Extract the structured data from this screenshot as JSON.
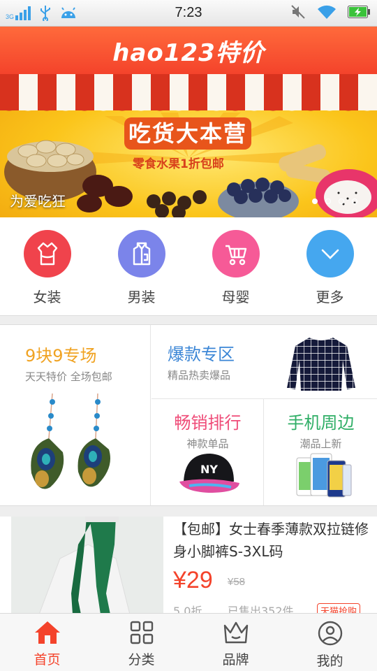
{
  "status_bar": {
    "network": "3G",
    "time": "7:23"
  },
  "header": {
    "logo": "hao123特价"
  },
  "banner": {
    "title": "吃货大本营",
    "subtitle": "零食水果1折包邮",
    "caption": "为爱吃狂",
    "slides": 4,
    "active_slide": 1
  },
  "categories": [
    {
      "label": "女装",
      "icon": "dress-icon",
      "color": "#f0434c"
    },
    {
      "label": "男装",
      "icon": "shirt-icon",
      "color": "#7b84ea"
    },
    {
      "label": "母婴",
      "icon": "stroller-icon",
      "color": "#f65a97"
    },
    {
      "label": "更多",
      "icon": "chevron-down-icon",
      "color": "#45a7ef"
    }
  ],
  "promos": {
    "nine": {
      "title": "9块9专场",
      "subtitle": "天天特价 全场包邮",
      "color": "#f0a323"
    },
    "hot": {
      "title": "爆款专区",
      "subtitle": "精品热卖爆品",
      "color": "#3b86d6"
    },
    "best": {
      "title": "畅销排行",
      "subtitle": "神款单品",
      "color": "#ef4c78"
    },
    "phone": {
      "title": "手机周边",
      "subtitle": "潮品上新",
      "color": "#2fae66"
    }
  },
  "product": {
    "title": "【包邮】女士春季薄款双拉链修身小脚裤S-3XL码",
    "price": "¥29",
    "original_price": "¥58",
    "discount": "5.0折",
    "sold": "已售出352件",
    "tag": "天猫抢购"
  },
  "nav": [
    {
      "label": "首页",
      "icon": "home-icon",
      "active": true
    },
    {
      "label": "分类",
      "icon": "grid-icon",
      "active": false
    },
    {
      "label": "品牌",
      "icon": "crown-icon",
      "active": false
    },
    {
      "label": "我的",
      "icon": "user-icon",
      "active": false
    }
  ]
}
